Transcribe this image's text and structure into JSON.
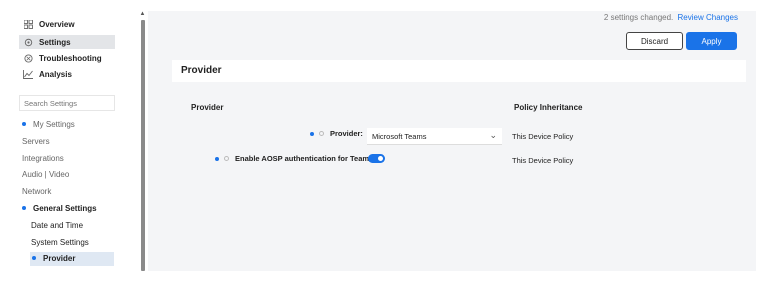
{
  "sidebar": {
    "nav": [
      {
        "label": "Overview",
        "icon": "grid-icon"
      },
      {
        "label": "Settings",
        "icon": "gear-icon"
      },
      {
        "label": "Troubleshooting",
        "icon": "wrench-icon"
      },
      {
        "label": "Analysis",
        "icon": "chart-icon"
      }
    ],
    "search_placeholder": "Search Settings",
    "tree": [
      {
        "label": "My Settings"
      },
      {
        "label": "Servers"
      },
      {
        "label": "Integrations"
      },
      {
        "label": "Audio | Video"
      },
      {
        "label": "Network"
      },
      {
        "label": "General Settings"
      },
      {
        "label": "Date and Time"
      },
      {
        "label": "System Settings"
      },
      {
        "label": "Provider"
      }
    ]
  },
  "header": {
    "changes_text": "2 settings changed.",
    "review_link": "Review Changes",
    "discard_label": "Discard",
    "apply_label": "Apply"
  },
  "section": {
    "title": "Provider",
    "col_setting": "Provider",
    "col_policy": "Policy Inheritance",
    "rows": [
      {
        "label": "Provider:",
        "value": "Microsoft Teams",
        "policy": "This Device Policy"
      },
      {
        "label": "Enable AOSP authentication for Teams:",
        "toggle_on": true,
        "policy": "This Device Policy"
      }
    ]
  },
  "colors": {
    "accent": "#1a73e8"
  }
}
